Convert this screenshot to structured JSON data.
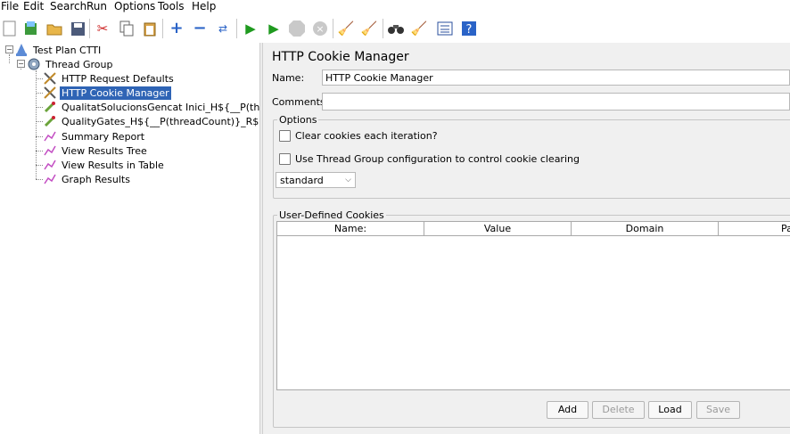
{
  "menu": [
    "File",
    "Edit",
    "Search",
    "Run",
    "Options",
    "Tools",
    "Help"
  ],
  "toolbar_icons": [
    "new-icon",
    "templates-icon",
    "open-icon",
    "save-icon",
    "cut-icon",
    "copy-icon",
    "paste-icon",
    "expand-icon",
    "collapse-icon",
    "toggle-icon",
    "start-icon",
    "start-no-pauses-icon",
    "stop-icon",
    "shutdown-icon",
    "clear-icon",
    "clear-all-icon",
    "search-icon",
    "reset-search-icon",
    "function-helper-icon",
    "help-icon"
  ],
  "tree": {
    "root": "Test Plan CTTI",
    "group": "Thread Group",
    "items": [
      "HTTP Request Defaults",
      "HTTP Cookie Manager",
      "QualitatSolucionsGencat Inici_H${__P(threadCount)}_R${__P(rampUp)}",
      "QualityGates_H${__P(threadCount)}_R${__P(rampUp)}",
      "Summary Report",
      "View Results Tree",
      "View Results in Table",
      "Graph Results"
    ]
  },
  "panel": {
    "title": "HTTP Cookie Manager",
    "name_label": "Name:",
    "name_value": "HTTP Cookie Manager",
    "comments_label": "Comments:",
    "comments_value": "",
    "options": {
      "title": "Options",
      "clear_each_iteration": "Clear cookies each iteration?",
      "use_thread_group_config": "Use Thread Group configuration to control cookie clearing",
      "policy": "standard"
    },
    "cookies": {
      "title": "User-Defined Cookies",
      "columns": [
        "Name:",
        "Value",
        "Domain",
        "Pa"
      ]
    },
    "buttons": {
      "add": "Add",
      "delete": "Delete",
      "load": "Load",
      "save": "Save"
    }
  }
}
